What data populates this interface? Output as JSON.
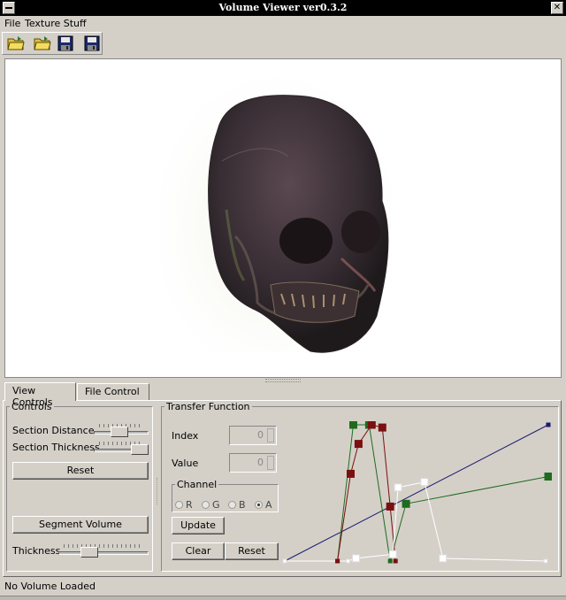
{
  "window": {
    "title": "Volume Viewer     ver0.3.2",
    "menu": [
      "File",
      "Texture Stuff"
    ]
  },
  "toolbar": {
    "icons": [
      "open-folder-icon",
      "open-folder-icon",
      "save-disk-icon",
      "save-as-disk-icon"
    ]
  },
  "tabs": [
    {
      "label": "View Controls",
      "active": true
    },
    {
      "label": "File Control",
      "active": false
    }
  ],
  "controls": {
    "title": "Controls",
    "section_distance_label": "Section Distance",
    "section_distance_value": 0.45,
    "section_thickness_label": "Section Thickness",
    "section_thickness_value": 1.0,
    "reset_label": "Reset",
    "segment_volume_label": "Segment Volume",
    "thickness_label": "Thickness",
    "thickness_value": 0.3
  },
  "transfer_function": {
    "title": "Transfer Function",
    "index_label": "Index",
    "index_value": "0",
    "value_label": "Value",
    "value_value": "0",
    "channel_title": "Channel",
    "channels": [
      {
        "label": "R",
        "selected": false
      },
      {
        "label": "G",
        "selected": false
      },
      {
        "label": "B",
        "selected": false
      },
      {
        "label": "A",
        "selected": true
      }
    ],
    "update_label": "Update",
    "clear_label": "Clear",
    "reset_label": "Reset"
  },
  "chart_data": {
    "type": "line",
    "xlim": [
      0,
      1
    ],
    "ylim": [
      0,
      1
    ],
    "series": [
      {
        "color": "#1a1a6e",
        "x": [
          0,
          1
        ],
        "y": [
          0,
          1
        ]
      },
      {
        "color": "#1f6b1f",
        "x": [
          0.2,
          0.26,
          0.32,
          0.4,
          0.46,
          1.0
        ],
        "y": [
          0.0,
          1.0,
          1.0,
          0.0,
          0.42,
          0.62
        ]
      },
      {
        "color": "#7a1010",
        "x": [
          0.2,
          0.25,
          0.28,
          0.33,
          0.37,
          0.4,
          0.42
        ],
        "y": [
          0.0,
          0.64,
          0.86,
          1.0,
          0.98,
          0.4,
          0.0
        ]
      },
      {
        "color": "#ffffff",
        "x": [
          0.0,
          0.24,
          0.27,
          0.41,
          0.43,
          0.53,
          0.6,
          0.99
        ],
        "y": [
          0.0,
          0.0,
          0.02,
          0.05,
          0.54,
          0.58,
          0.02,
          0.0
        ]
      }
    ]
  },
  "status": {
    "text": "No Volume Loaded"
  }
}
